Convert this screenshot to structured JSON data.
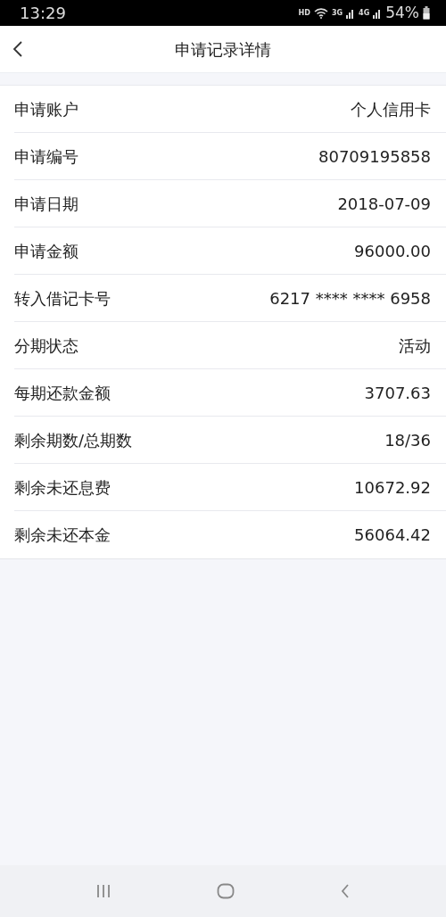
{
  "status_bar": {
    "time": "13:29",
    "hd": "HD",
    "net_3g": "3G",
    "net_4g": "4G",
    "battery": "54%"
  },
  "header": {
    "title": "申请记录详情"
  },
  "rows": [
    {
      "label": "申请账户",
      "value": "个人信用卡"
    },
    {
      "label": "申请编号",
      "value": "80709195858"
    },
    {
      "label": "申请日期",
      "value": "2018-07-09"
    },
    {
      "label": "申请金额",
      "value": "96000.00"
    },
    {
      "label": "转入借记卡号",
      "value": "6217 **** **** 6958"
    },
    {
      "label": "分期状态",
      "value": "活动"
    },
    {
      "label": "每期还款金额",
      "value": "3707.63"
    },
    {
      "label": "剩余期数/总期数",
      "value": "18/36"
    },
    {
      "label": "剩余未还息费",
      "value": "10672.92"
    },
    {
      "label": "剩余未还本金",
      "value": "56064.42"
    }
  ]
}
